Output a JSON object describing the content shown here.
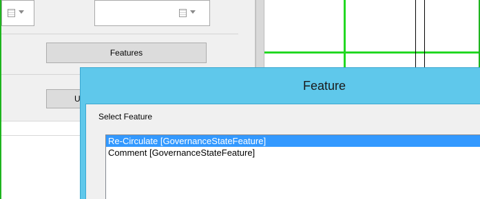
{
  "left_panel": {
    "features_button_label": "Features",
    "lower_button_label": "U"
  },
  "dialog": {
    "title": "Feature",
    "select_label": "Select Feature",
    "list_items": [
      {
        "label": "Re-Circulate [GovernanceStateFeature]",
        "selected": true
      },
      {
        "label": "Comment [GovernanceStateFeature]",
        "selected": false
      }
    ]
  },
  "colors": {
    "dialog_title_bar": "#5fc8eb",
    "selection": "#3399ff",
    "grid_line_green": "#22d822",
    "frame_green": "#1eb41e"
  },
  "icons": {
    "dropdown_icon": "grid-dropdown-icon",
    "dropdown_caret": "chevron-down-icon"
  }
}
